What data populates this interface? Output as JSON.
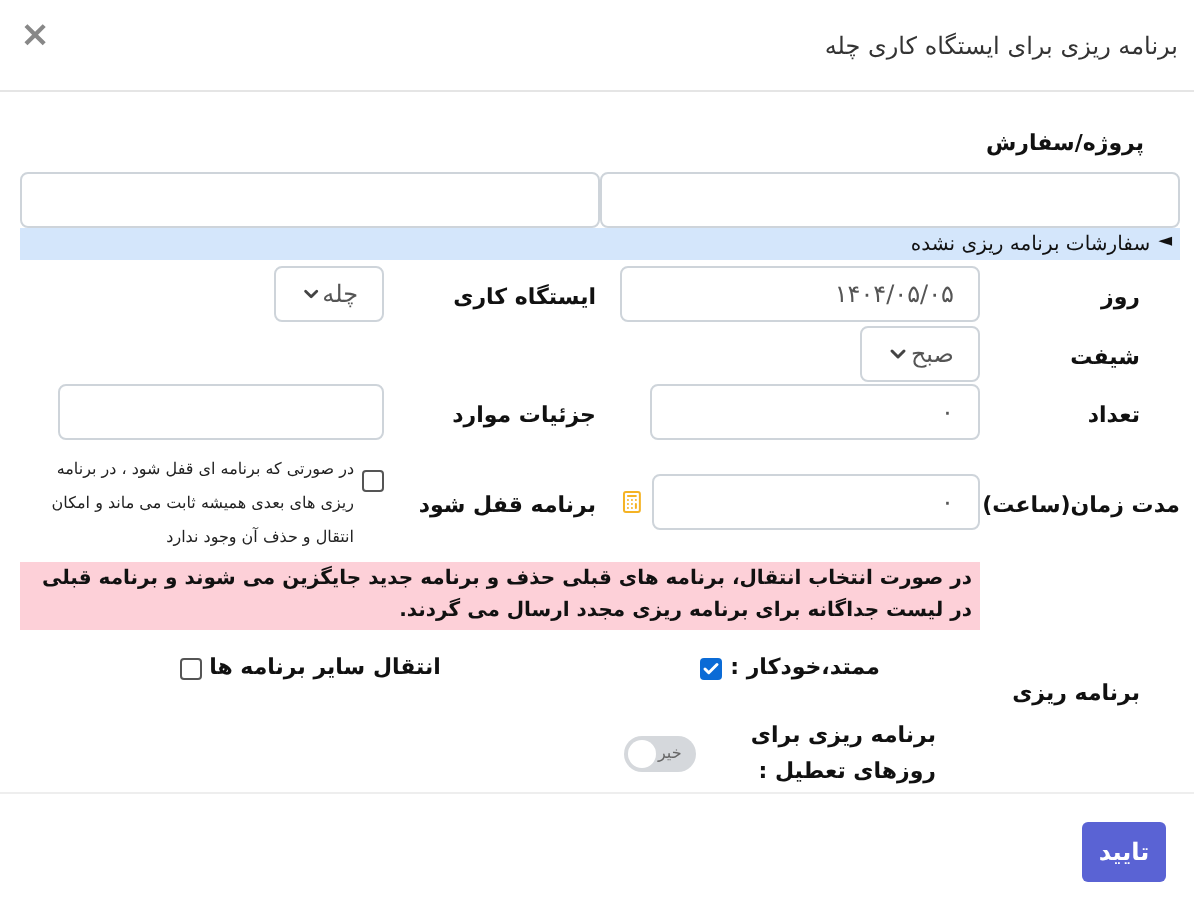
{
  "dialog": {
    "title": "برنامه ریزی برای ایستگاه کاری چله",
    "close": "×"
  },
  "project": {
    "label": "پروژه/سفارش"
  },
  "unplanned": {
    "marker": "◄",
    "label": "سفارشات برنامه ریزی نشده"
  },
  "day": {
    "label": "روز",
    "value": "۱۴۰۴/۰۵/۰۵"
  },
  "workstation": {
    "label": "ایستگاه کاری",
    "value": "چله"
  },
  "shift": {
    "label": "شیفت",
    "value": "صبح"
  },
  "count": {
    "label": "تعداد",
    "value": "۰"
  },
  "details": {
    "label": "جزئیات موارد"
  },
  "duration": {
    "label": "مدت زمان(ساعت)",
    "value": "۰"
  },
  "lock": {
    "label": "برنامه قفل شود",
    "checked": false,
    "note": "در صورتی که برنامه ای قفل شود ، در برنامه ریزی های بعدی همیشه ثابت می ماند و امکان انتقال و حذف آن وجود ندارد"
  },
  "alert": "در صورت انتخاب انتقال، برنامه های قبلی حذف و برنامه جدید جایگزین می شوند و برنامه قبلی در لیست جداگانه برای برنامه ریزی مجدد ارسال می گردند.",
  "planning": {
    "label": "برنامه ریزی",
    "options": [
      {
        "label": "ممتد،خودکار :",
        "checked": true
      },
      {
        "label": "انتقال سایر برنامه ها",
        "checked": false
      }
    ]
  },
  "holidays": {
    "label": "برنامه ریزی برای روزهای تعطیل :",
    "on": false,
    "state_label": "خیر"
  },
  "confirm": "تایید"
}
